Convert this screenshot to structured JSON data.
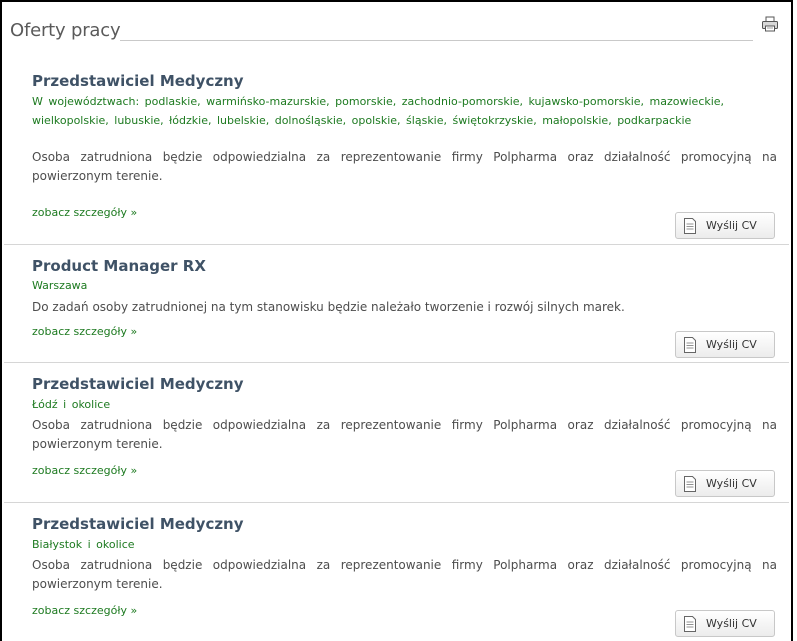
{
  "header": {
    "title": "Oferty pracy"
  },
  "icons": {
    "print": "printer-icon",
    "cv": "document-icon"
  },
  "colors": {
    "title": "#3f5266",
    "location": "#1d7a20",
    "description": "#4d4d4d",
    "link": "#1d7a20"
  },
  "offers": [
    {
      "title": "Przedstawiciel Medyczny",
      "location": "W województwach: podlaskie, warmińsko-mazurskie, pomorskie, zachodnio-pomorskie, kujawsko-pomorskie, mazowieckie, wielkopolskie, lubuskie, łódzkie, lubelskie, dolnośląskie, opolskie, śląskie, świętokrzyskie, małopolskie, podkarpackie",
      "description": "Osoba zatrudniona będzie odpowiedzialna za reprezentowanie firmy Polpharma oraz działalność promocyjną na powierzonym terenie.",
      "link": "zobacz szczegóły »",
      "cv_label": "Wyślij CV"
    },
    {
      "title": "Product Manager RX",
      "location": "Warszawa",
      "description": "Do zadań osoby zatrudnionej na tym stanowisku będzie należało tworzenie i rozwój silnych marek.",
      "link": "zobacz szczegóły »",
      "cv_label": "Wyślij CV"
    },
    {
      "title": "Przedstawiciel Medyczny",
      "location": "Łódź i okolice",
      "description": "Osoba zatrudniona będzie odpowiedzialna za reprezentowanie firmy Polpharma oraz działalność promocyjną na powierzonym terenie.",
      "link": "zobacz szczegóły »",
      "cv_label": "Wyślij CV"
    },
    {
      "title": "Przedstawiciel Medyczny",
      "location": "Białystok i okolice",
      "description": "Osoba zatrudniona będzie odpowiedzialna za reprezentowanie firmy Polpharma oraz działalność promocyjną na powierzonym terenie.",
      "link": "zobacz szczegóły »",
      "cv_label": "Wyślij CV"
    }
  ]
}
